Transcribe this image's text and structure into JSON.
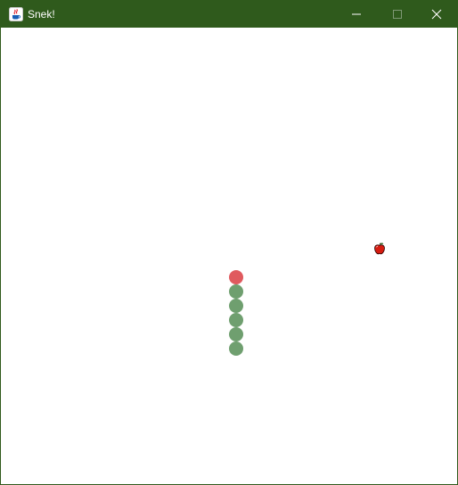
{
  "window": {
    "title": "Snek!",
    "icon": "java-cup-icon",
    "controls": [
      "minimize-icon",
      "maximize-icon",
      "close-icon"
    ]
  },
  "colors": {
    "titlebar": "#2f5a1c",
    "snake_head": "#e05a5e",
    "snake_body": "#6f9f6f",
    "apple": "#d61c10"
  },
  "game": {
    "snake_length": 6,
    "apple_icon": "apple-icon"
  }
}
